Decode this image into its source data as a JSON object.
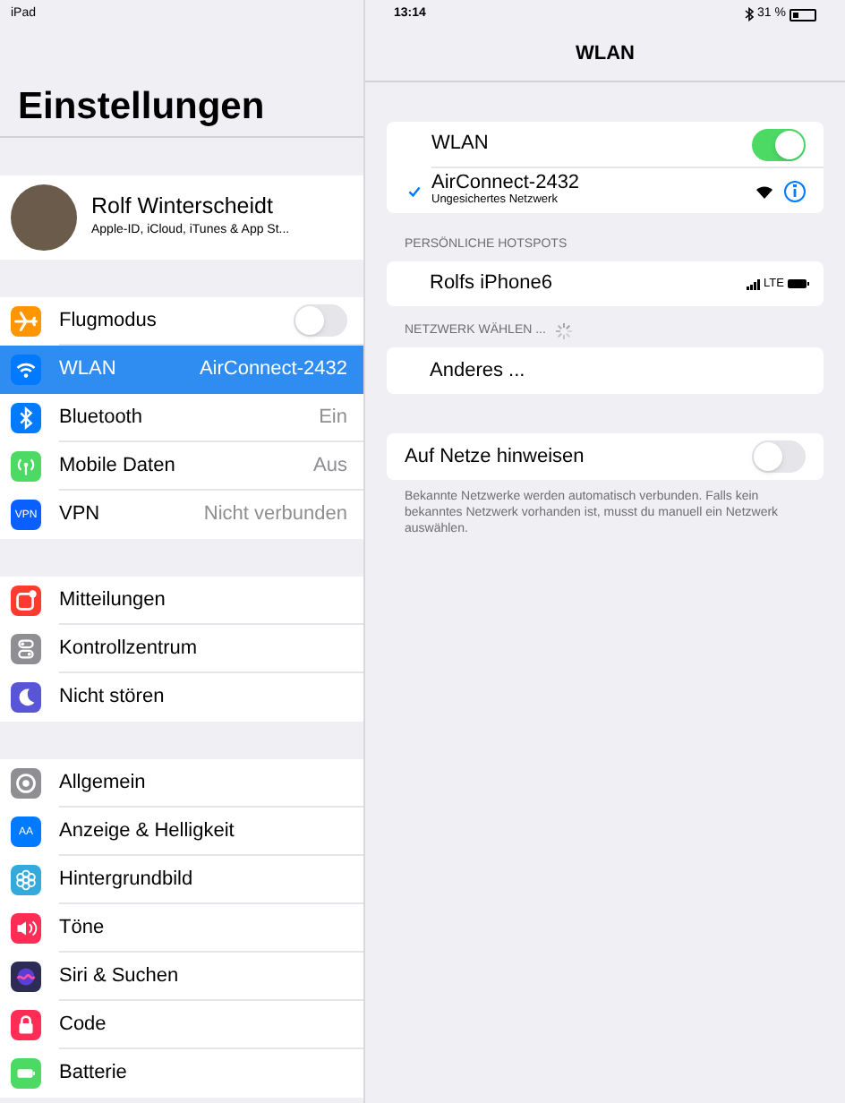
{
  "status_bar": {
    "device": "iPad",
    "time": "13:14",
    "battery": "31 %"
  },
  "sidebar": {
    "title": "Einstellungen",
    "profile": {
      "name": "Rolf Winterscheidt",
      "subtitle": "Apple-ID, iCloud, iTunes & App St..."
    },
    "groups": [
      [
        {
          "label": "Flugmodus",
          "kind": "toggle",
          "on": false,
          "selected": false,
          "color": "#ff9500"
        },
        {
          "label": "WLAN",
          "kind": "detail",
          "value": "AirConnect-2432",
          "selected": true,
          "color": "#007aff"
        },
        {
          "label": "Bluetooth",
          "kind": "detail",
          "value": "Ein",
          "selected": false,
          "color": "#007aff"
        },
        {
          "label": "Mobile Daten",
          "kind": "detail",
          "value": "Aus",
          "selected": false,
          "color": "#4cd964"
        },
        {
          "label": "VPN",
          "kind": "detail",
          "value": "Nicht verbunden",
          "selected": false,
          "color": "#0a60ff",
          "icon_text": "VPN"
        }
      ],
      [
        {
          "label": "Mitteilungen",
          "kind": "plain",
          "selected": false,
          "color": "#ff3b30"
        },
        {
          "label": "Kontrollzentrum",
          "kind": "plain",
          "selected": false,
          "color": "#8e8e93"
        },
        {
          "label": "Nicht stören",
          "kind": "plain",
          "selected": false,
          "color": "#5856d6"
        }
      ],
      [
        {
          "label": "Allgemein",
          "kind": "plain",
          "selected": false,
          "color": "#8e8e93"
        },
        {
          "label": "Anzeige & Helligkeit",
          "kind": "plain",
          "selected": false,
          "color": "#007aff",
          "icon_text": "AA"
        },
        {
          "label": "Hintergrundbild",
          "kind": "plain",
          "selected": false,
          "color": "#34aadc"
        },
        {
          "label": "Töne",
          "kind": "plain",
          "selected": false,
          "color": "#ff2d55"
        },
        {
          "label": "Siri & Suchen",
          "kind": "plain",
          "selected": false,
          "color": "#2c2c54"
        },
        {
          "label": "Code",
          "kind": "plain",
          "selected": false,
          "color": "#ff2d55"
        },
        {
          "label": "Batterie",
          "kind": "plain",
          "selected": false,
          "color": "#4cd964"
        }
      ]
    ]
  },
  "detail": {
    "title": "WLAN",
    "wlan": {
      "label": "WLAN",
      "on": true
    },
    "current_network": {
      "name": "AirConnect-2432",
      "subtitle": "Ungesichertes Netzwerk",
      "selected": true
    },
    "hotspots": {
      "header": "PERSÖNLICHE HOTSPOTS",
      "items": [
        {
          "name": "Rolfs iPhone6",
          "network": "LTE"
        }
      ]
    },
    "networks": {
      "header": "NETZWERK WÄHLEN ...",
      "items": [
        {
          "name": "Anderes ..."
        }
      ]
    },
    "ask": {
      "label": "Auf Netze hinweisen",
      "on": false
    },
    "footnote": "Bekannte Netzwerke werden automatisch verbunden. Falls kein bekanntes Netzwerk vorhanden ist, musst du manuell ein Netzwerk auswählen."
  }
}
